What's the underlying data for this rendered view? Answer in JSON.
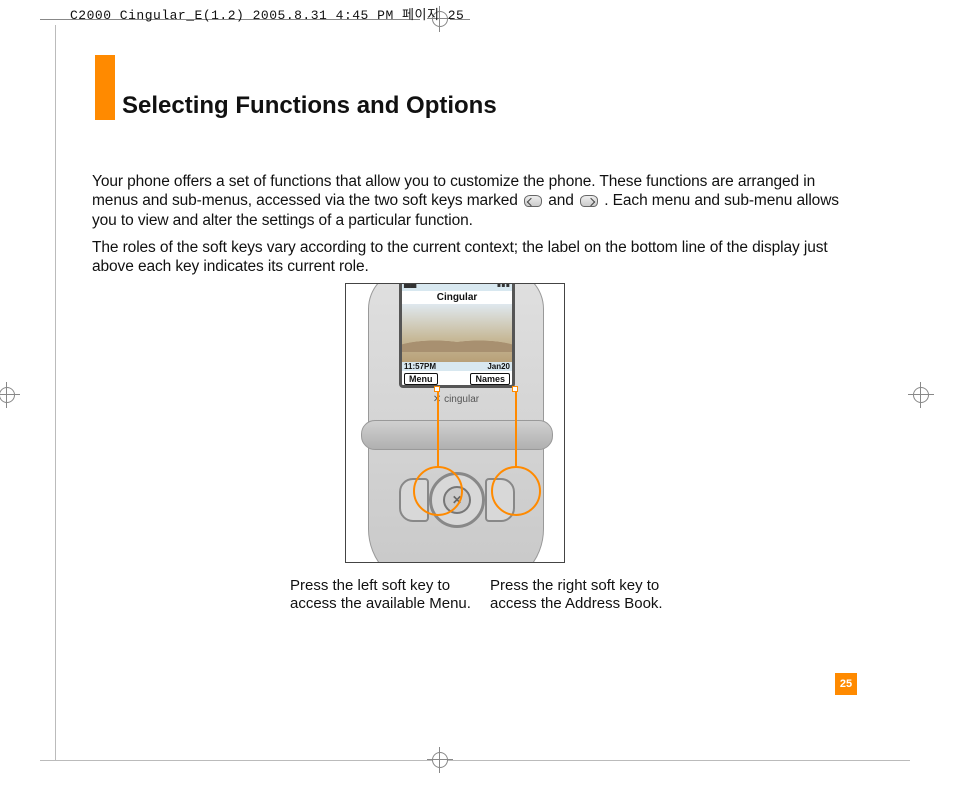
{
  "meta_header": "C2000 Cingular_E(1.2)  2005.8.31  4:45 PM  페이지 25",
  "section_title": "Selecting Functions and Options",
  "para1_a": "Your phone offers a set of functions that allow you to customize the phone. These functions are arranged in menus and sub-menus, accessed via the two soft keys marked ",
  "para1_b": " and ",
  "para1_c": ". Each menu and sub-menu allows you to view and alter the settings of a particular function.",
  "para2": "The roles of the soft keys vary according to the current context; the label on the bottom line of the display just above each key indicates its current role.",
  "screen": {
    "signal": "▙▟",
    "battery": "▮▮▮",
    "carrier": "Cingular",
    "time": "11:57PM",
    "date": "Jan20",
    "soft_left": "Menu",
    "soft_right": "Names",
    "brand": "✕ cingular"
  },
  "dpad_center": "✕",
  "caption_left": "Press the left soft key to access the available Menu.",
  "caption_right": "Press the right soft key to access the Address Book.",
  "page_number": "25"
}
